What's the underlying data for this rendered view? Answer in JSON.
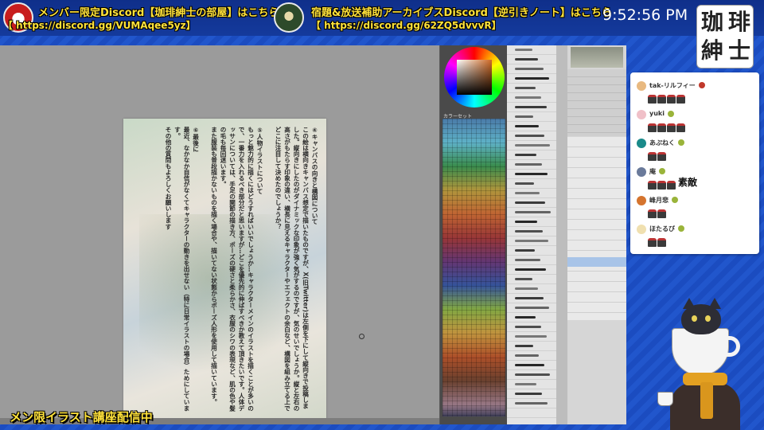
{
  "banner": {
    "promo1": {
      "title": "メンバー限定Discord【珈琲紳士の部屋】はこちら",
      "link": "【 https://discord.gg/VUMAqee5yz】"
    },
    "promo2": {
      "title": "宿題&放送補助アーカイブスDiscord【逆引きノート】はこちら",
      "link": "【 https://discord.gg/62ZQ5dvvvR】"
    },
    "clock": "9:52:56 PM"
  },
  "logo": {
    "chars": [
      "珈",
      "琲",
      "紳",
      "士"
    ]
  },
  "canvas": {
    "paper_text": "④キャンバスの向きと構図について\nこの絵は横向きキャンバス想定で描いたものですが、X(旧Twitter)は左側を下にして縦向きで投稿しました。縦向きにしたのがダイナミックな印象が強く気がするのですが、気のせいでしょうか。縦と左右の高さがもたらす印象の違い、横長に見えるキャラクターやエフェクトの余白など、構図を組み立てる上でどこに注目して決めたのでしょうか？\n\n⑤人物イラストについて\nもっと魅力的に描くにはどうすればいいでしょうか…キャラクターメインのイラストを描くことが多いので、一番力を入れるべき部分だと思いますが…どこを優先的に伸ばすべきか教えて頂きたいです。人体デッサンについては、手足の関節の描き方、ポーズの硬さと柔らかさ、衣服のシワの表現など、肌の色や髪の毛も毎回迷います。\nまた服装も普段描かないものを描く場合や、描いてない状態からポーズ人形を使用して描いています。\n\n⑥最後に\n最近、なかなか自信がなくてキャラクターの動きを出せない（特に日常イラストの場合）ためにしています。\nその他の質問もよろしくお願いします"
  },
  "color_panel": {
    "set_label": "カラーセット"
  },
  "chat": {
    "messages": [
      {
        "name": "tak-リルフィー",
        "avatar_color": "#e8b980",
        "badge_color": "#c0392b",
        "stamps": 4,
        "text": ""
      },
      {
        "name": "yuki",
        "avatar_color": "#f0c0c8",
        "badge_color": "#9ab43a",
        "stamps": 4,
        "text": ""
      },
      {
        "name": "あぷねく",
        "avatar_color": "#1a8a8a",
        "badge_color": "#9ab43a",
        "stamps": 2,
        "text": ""
      },
      {
        "name": "庵",
        "avatar_color": "#6a7a9a",
        "badge_color": "#9ab43a",
        "stamps": 3,
        "text": "素敵"
      },
      {
        "name": "峰月悲",
        "avatar_color": "#d5742e",
        "badge_color": "#9ab43a",
        "stamps": 2,
        "text": ""
      },
      {
        "name": "ほたるび",
        "avatar_color": "#f0e0b0",
        "badge_color": "#9ab43a",
        "stamps": 2,
        "text": ""
      }
    ]
  },
  "footer": {
    "stream_label": "メン限イラスト講座配信中"
  }
}
